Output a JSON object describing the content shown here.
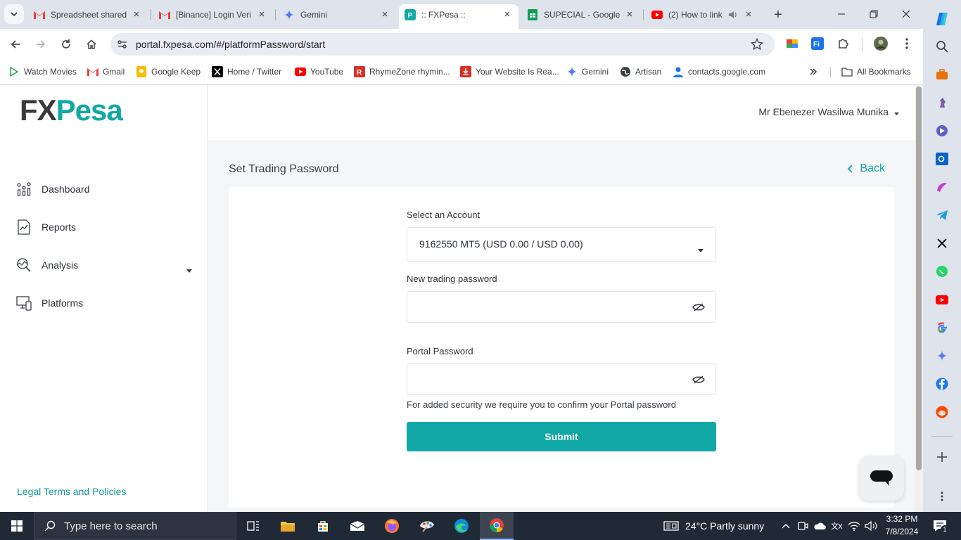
{
  "browser": {
    "tabs": [
      {
        "title": "Spreadsheet shared",
        "icon": "gmail-icon"
      },
      {
        "title": "[Binance] Login Veri",
        "icon": "gmail-icon"
      },
      {
        "title": "Gemini",
        "icon": "gemini-icon"
      },
      {
        "title": ":: FXPesa ::",
        "icon": "fxpesa-icon"
      },
      {
        "title": "SUPECIAL - Google",
        "icon": "google-sheets-icon"
      },
      {
        "title": "(2) How to link",
        "icon": "youtube-icon"
      }
    ],
    "url": "portal.fxpesa.com/#/platformPassword/start",
    "bookmarks": [
      {
        "label": "Watch Movies",
        "icon": "play-icon"
      },
      {
        "label": "Gmail",
        "icon": "gmail-icon"
      },
      {
        "label": "Google Keep",
        "icon": "keep-icon"
      },
      {
        "label": "Home / Twitter",
        "icon": "x-icon"
      },
      {
        "label": "YouTube",
        "icon": "youtube-icon"
      },
      {
        "label": "RhymeZone rhymin...",
        "icon": "rhymezone-icon"
      },
      {
        "label": "Your Website Is Rea...",
        "icon": "download-icon"
      },
      {
        "label": "Gemini",
        "icon": "gemini-icon"
      },
      {
        "label": "Artisan",
        "icon": "globe-icon"
      },
      {
        "label": "contacts.google.com",
        "icon": "contacts-icon"
      }
    ],
    "all_bookmarks": "All Bookmarks"
  },
  "app": {
    "logo_fx": "FX",
    "logo_pesa": "Pesa",
    "user_name": "Mr Ebenezer Wasilwa Munika",
    "nav": [
      {
        "label": "Dashboard",
        "icon": "dashboard-icon"
      },
      {
        "label": "Reports",
        "icon": "reports-icon"
      },
      {
        "label": "Analysis",
        "icon": "analysis-icon"
      },
      {
        "label": "Platforms",
        "icon": "platforms-icon"
      }
    ],
    "legal": "Legal Terms and Policies",
    "page_title": "Set Trading Password",
    "back": "Back",
    "form": {
      "account_label": "Select an Account",
      "account_value": "9162550 MT5 (USD 0.00 / USD 0.00)",
      "new_password_label": "New trading password",
      "new_password_value": "",
      "portal_password_label": "Portal Password",
      "portal_password_value": "",
      "hint": "For added security we require you to confirm your Portal password",
      "submit": "Submit"
    }
  },
  "taskbar": {
    "search_placeholder": "Type here to search",
    "weather": "24°C  Partly sunny",
    "time": "3:32 PM",
    "date": "7/8/2024",
    "notification_count": "1"
  },
  "colors": {
    "brand_teal": "#11a8a6",
    "brand_dark": "#3a3a3a"
  }
}
